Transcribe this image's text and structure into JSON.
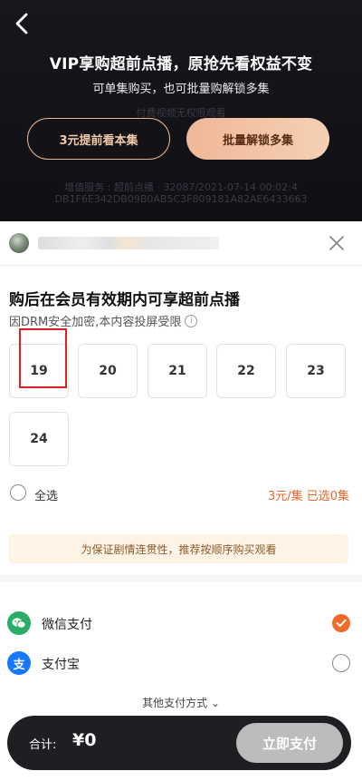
{
  "header": {
    "title": "VIP享购超前点播，原抢先看权益不变",
    "subtitle": "可单集购买，也可批量购解锁多集",
    "faded_line1": "付费视频无权限观看",
    "faded_line2": "增值服务 : 超前点播 · 32087/2021-07-14 00:02:4",
    "faded_line3": "DB1F6E342DB09B0AB5C3F809181A82AE6433663",
    "btn_single": "3元提前看本集",
    "btn_batch": "批量解锁多集"
  },
  "sheet": {
    "section_title": "购后在会员有效期内可享超前点播",
    "drm_note": "因DRM安全加密,本内容投屏受限",
    "info_glyph": "i",
    "episodes": [
      "19",
      "20",
      "21",
      "22",
      "23",
      "24"
    ],
    "select_all": "全选",
    "price_info": "3元/集 已选0集",
    "tip": "为保证剧情连贯性，推荐按顺序购买观看",
    "payments": [
      {
        "label": "微信支付",
        "icon": "wechat-pay-icon",
        "glyph": "",
        "color": "#2aae67",
        "selected": true
      },
      {
        "label": "支付宝",
        "icon": "alipay-icon",
        "glyph": "支",
        "color": "#1677ff",
        "selected": false
      }
    ],
    "other_payment": "其他支付方式 ⌄",
    "total_label": "合计:",
    "total_amount": "¥0",
    "pay_button": "立即支付"
  }
}
